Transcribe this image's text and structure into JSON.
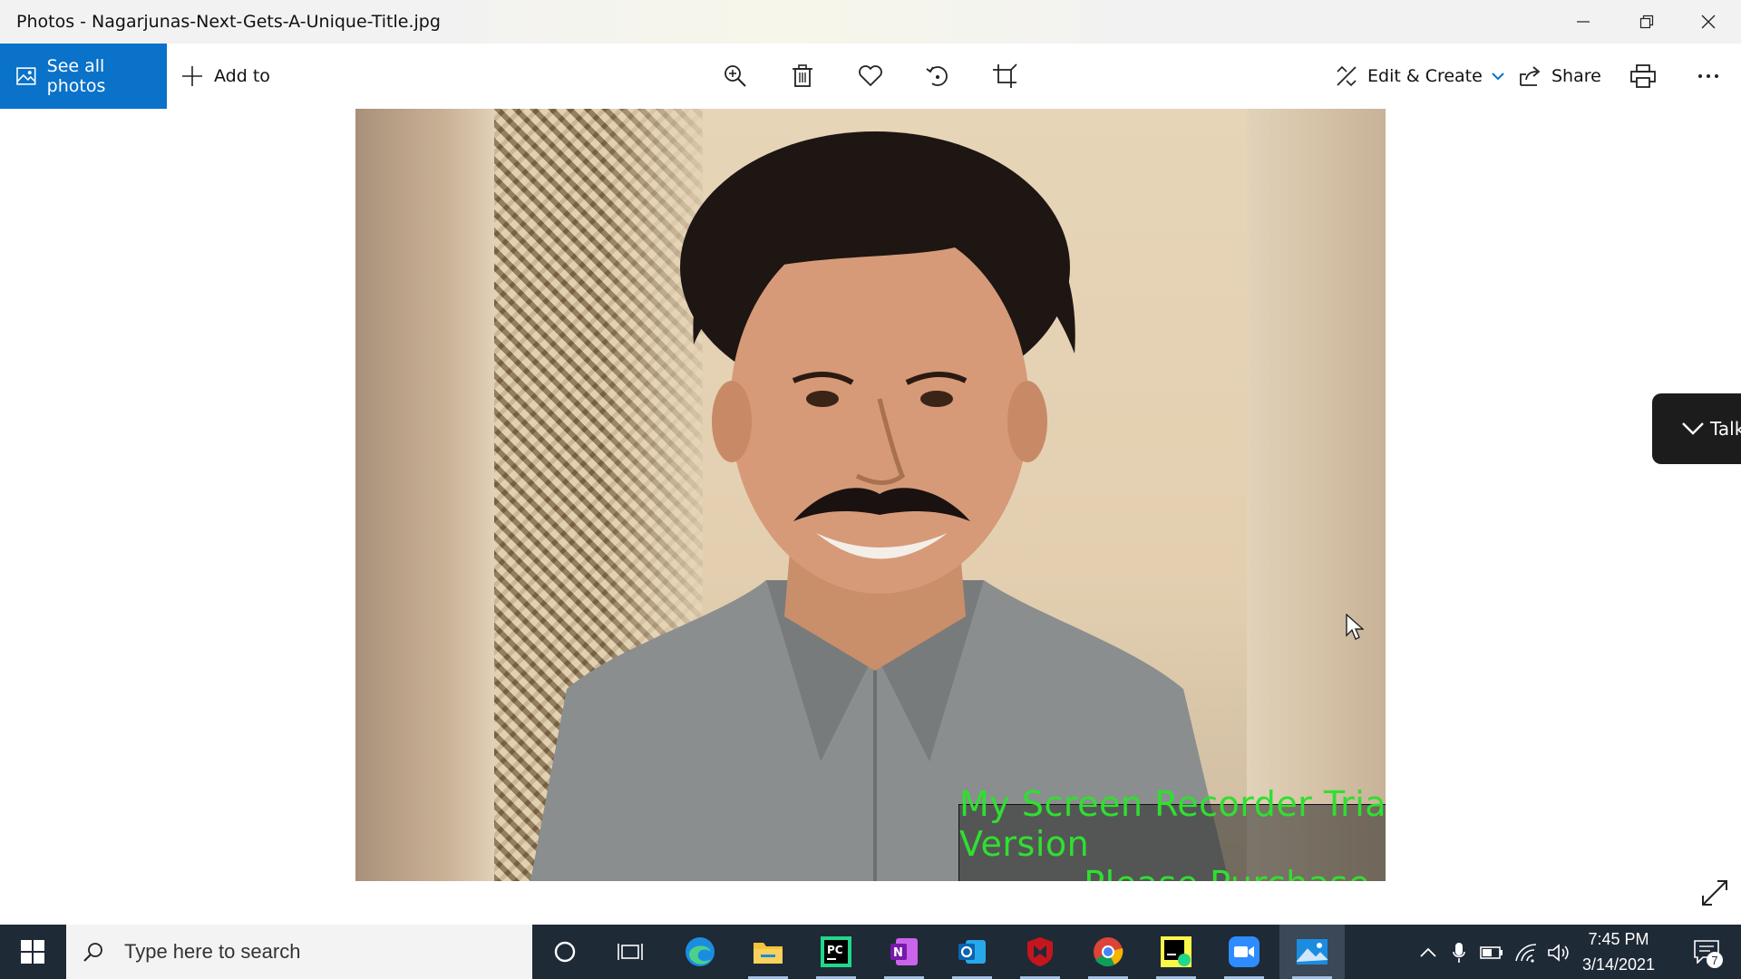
{
  "window": {
    "title": "Photos - Nagarjunas-Next-Gets-A-Unique-Title.jpg",
    "controls": [
      "minimize-icon",
      "restore-icon",
      "close-icon"
    ]
  },
  "toolbar": {
    "see_all_label": "See all photos",
    "add_to_label": "Add to",
    "tools": [
      "zoom-icon",
      "delete-icon",
      "favorite-icon",
      "rotate-icon",
      "crop-icon"
    ],
    "edit_create_label": "Edit & Create",
    "share_label": "Share",
    "print_icon": "print-icon",
    "more_icon": "more-icon",
    "accent": "#0a72c9"
  },
  "photo": {
    "watermark_line1": "My Screen Recorder Trial Version",
    "watermark_line2": "Please Purchase",
    "watermark_color": "#2fe02f"
  },
  "talk_panel": {
    "label": "Talk"
  },
  "taskbar": {
    "search_placeholder": "Type here to search",
    "apps": [
      "cortana-icon",
      "task-view-icon",
      "edge-icon",
      "file-explorer-icon",
      "pycharm-icon",
      "onenote-icon",
      "outlook-icon",
      "mcafee-icon",
      "chrome-icon",
      "pycharm-ce-icon",
      "zoom-icon",
      "photos-icon"
    ],
    "active_app": "photos-icon",
    "clock_time": "7:45 PM",
    "clock_date": "3/14/2021",
    "notification_count": "7",
    "background": "#1f2a37"
  }
}
